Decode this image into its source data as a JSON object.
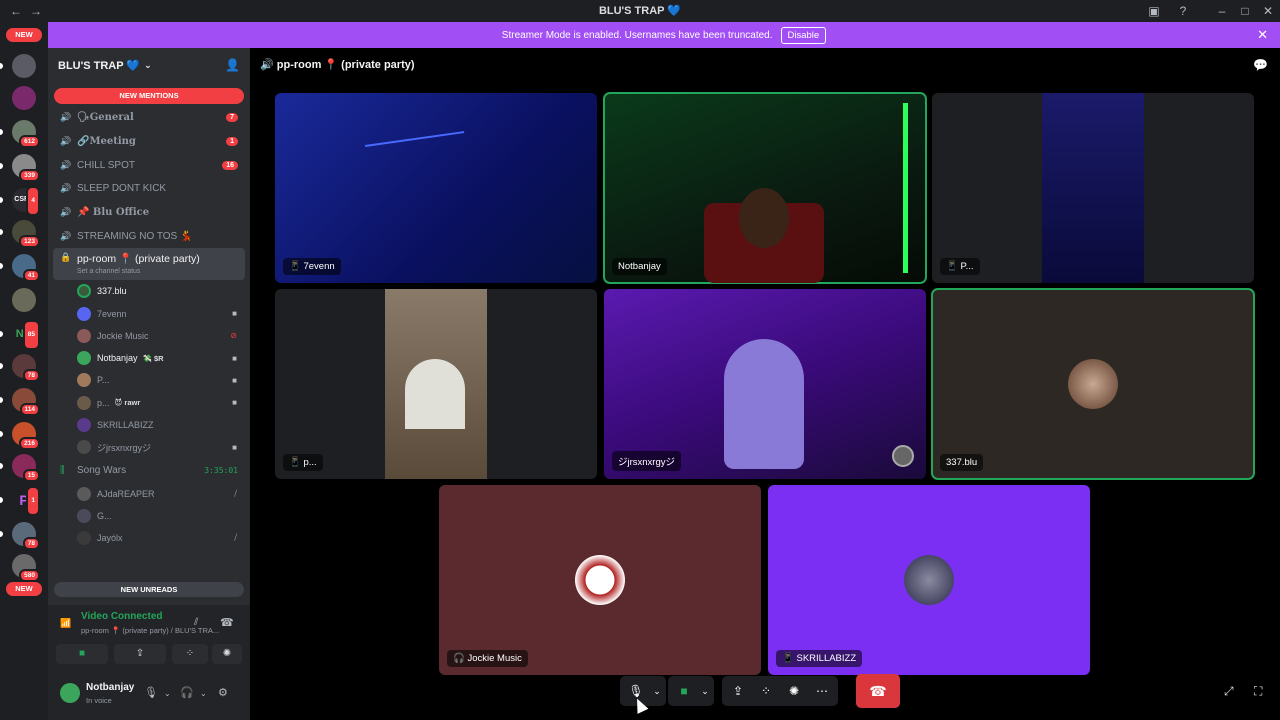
{
  "window": {
    "title": "BLU'S TRAP 💙"
  },
  "banner": {
    "text": "Streamer Mode is enabled. Usernames have been truncated.",
    "disable_label": "Disable"
  },
  "server_rail": {
    "top_new": "NEW",
    "bottom_new": "NEW",
    "badges": [
      "612",
      "339",
      "4",
      "123",
      "41",
      "85",
      "78",
      "114",
      "216",
      "15",
      "1",
      "78",
      "580"
    ]
  },
  "guild": {
    "name": "BLU'S TRAP 💙"
  },
  "sidebar": {
    "new_mentions": "NEW MENTIONS",
    "channels": [
      {
        "name": "🗣General",
        "badge": "7",
        "bold": true
      },
      {
        "name": "🔗Meeting",
        "badge": "1",
        "bold": true
      },
      {
        "name": "CHILL SPOT",
        "badge": "16",
        "bold": false
      },
      {
        "name": "SLEEP DONT KICK",
        "badge": "",
        "bold": false
      },
      {
        "name": "📌 Blu Office",
        "badge": "",
        "bold": true
      },
      {
        "name": "STREAMING NO TOS 💃",
        "badge": "",
        "bold": false
      }
    ],
    "active_channel": {
      "name": "pp-room 📍 (private party)",
      "status": "Set a channel status"
    },
    "members": [
      {
        "name": "337.blu",
        "tag": "",
        "live": true
      },
      {
        "name": "7evenn",
        "tag": "",
        "live": false
      },
      {
        "name": "Jockie Music",
        "tag": "",
        "live": false
      },
      {
        "name": "Notbanjay",
        "tag": "💸 $R",
        "live": true
      },
      {
        "name": "P...",
        "tag": "",
        "live": false
      },
      {
        "name": "p...",
        "tag": "😈 rawr",
        "live": false
      },
      {
        "name": "SKRILLABIZZ",
        "tag": "",
        "live": false
      },
      {
        "name": "ジjrsxnxrgyジ",
        "tag": "",
        "live": false
      }
    ],
    "song_wars": {
      "name": "Song Wars",
      "time": "3:35:01"
    },
    "song_members": [
      "AJdaREAPER",
      "G...",
      "Jayólx"
    ],
    "new_unreads": "NEW UNREADS"
  },
  "voice": {
    "status": "Video Connected",
    "location": "pp-room 📍 (private party) / BLU'S TRA..."
  },
  "user": {
    "name": "Notbanjay",
    "status": "In voice"
  },
  "main": {
    "channel_title": "pp-room 📍 (private party)",
    "tiles": [
      {
        "label": "7evenn",
        "prefix": "📱"
      },
      {
        "label": "Notbanjay",
        "prefix": ""
      },
      {
        "label": "P...",
        "prefix": "📱"
      },
      {
        "label": "p...",
        "prefix": "📱"
      },
      {
        "label": "ジjrsxnxrgyジ",
        "prefix": ""
      },
      {
        "label": "337.blu",
        "prefix": ""
      },
      {
        "label": "Jockie Music",
        "prefix": "🎧"
      },
      {
        "label": "SKRILLABIZZ",
        "prefix": "📱"
      }
    ]
  },
  "icons": {
    "speaker": "🔊",
    "mic": "🎙",
    "camera": "📹",
    "screen": "🖥",
    "activities": "🚀",
    "soundboard": "🎵",
    "more": "⋯",
    "hangup": "📞",
    "popout": "⤢",
    "fullscreen": "⛶"
  },
  "colors": {
    "accent": "#a24ef5",
    "green": "#23a55a",
    "red": "#f23f43",
    "tile_brown": "#5a2a2e",
    "tile_purple": "#7b2ff2"
  }
}
